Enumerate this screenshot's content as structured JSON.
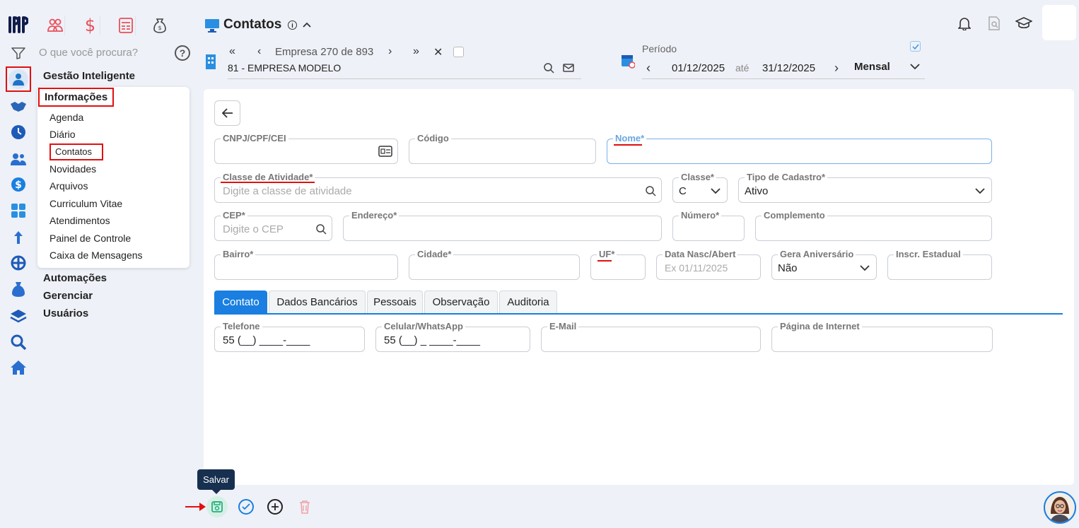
{
  "app": {
    "title": "Contatos"
  },
  "search": {
    "placeholder": "O que você procura?"
  },
  "company": {
    "nav_text": "Empresa 270 de 893",
    "name": "81 - EMPRESA MODELO"
  },
  "period": {
    "label": "Período",
    "start": "01/12/2025",
    "separator": "até",
    "end": "31/12/2025",
    "mode": "Mensal"
  },
  "sidebar": {
    "sections": {
      "gestao": "Gestão Inteligente",
      "informacoes": "Informações",
      "automacoes": "Automações",
      "gerenciar": "Gerenciar",
      "usuarios": "Usuários"
    },
    "sub_items": [
      "Agenda",
      "Diário",
      "Contatos",
      "Novidades",
      "Arquivos",
      "Curriculum Vitae",
      "Atendimentos",
      "Painel de Controle",
      "Caixa de Mensagens"
    ]
  },
  "form": {
    "cnpj": {
      "label": "CNPJ/CPF/CEI",
      "value": ""
    },
    "codigo": {
      "label": "Código",
      "value": ""
    },
    "nome": {
      "label": "Nome*",
      "value": ""
    },
    "classe_atividade": {
      "label": "Classe de Atividade*",
      "placeholder": "Digite a classe de atividade"
    },
    "classe": {
      "label": "Classe*",
      "value": "C"
    },
    "tipo_cadastro": {
      "label": "Tipo de Cadastro*",
      "value": "Ativo"
    },
    "cep": {
      "label": "CEP*",
      "placeholder": "Digite o CEP"
    },
    "endereco": {
      "label": "Endereço*",
      "value": ""
    },
    "numero": {
      "label": "Número*",
      "value": ""
    },
    "complemento": {
      "label": "Complemento",
      "value": ""
    },
    "bairro": {
      "label": "Bairro*",
      "value": ""
    },
    "cidade": {
      "label": "Cidade*",
      "value": ""
    },
    "uf": {
      "label": "UF*",
      "value": ""
    },
    "data_nasc": {
      "label": "Data Nasc/Abert",
      "placeholder": "Ex 01/11/2025"
    },
    "gera_aniversario": {
      "label": "Gera Aniversário",
      "value": "Não"
    },
    "inscr_estadual": {
      "label": "Inscr. Estadual",
      "value": ""
    }
  },
  "tabs": [
    "Contato",
    "Dados Bancários",
    "Pessoais",
    "Observação",
    "Auditoria"
  ],
  "contact": {
    "telefone": {
      "label": "Telefone",
      "value": "55 (__) ____-____"
    },
    "celular": {
      "label": "Celular/WhatsApp",
      "value": "55 (__) _ ____-____"
    },
    "email": {
      "label": "E-Mail",
      "value": ""
    },
    "pagina": {
      "label": "Página de Internet",
      "value": ""
    }
  },
  "toolbar": {
    "save_tooltip": "Salvar"
  },
  "colors": {
    "accent": "#1a7fe0",
    "annotation": "#e01010",
    "topicon": "#e8505b",
    "green": "#22b07d"
  }
}
